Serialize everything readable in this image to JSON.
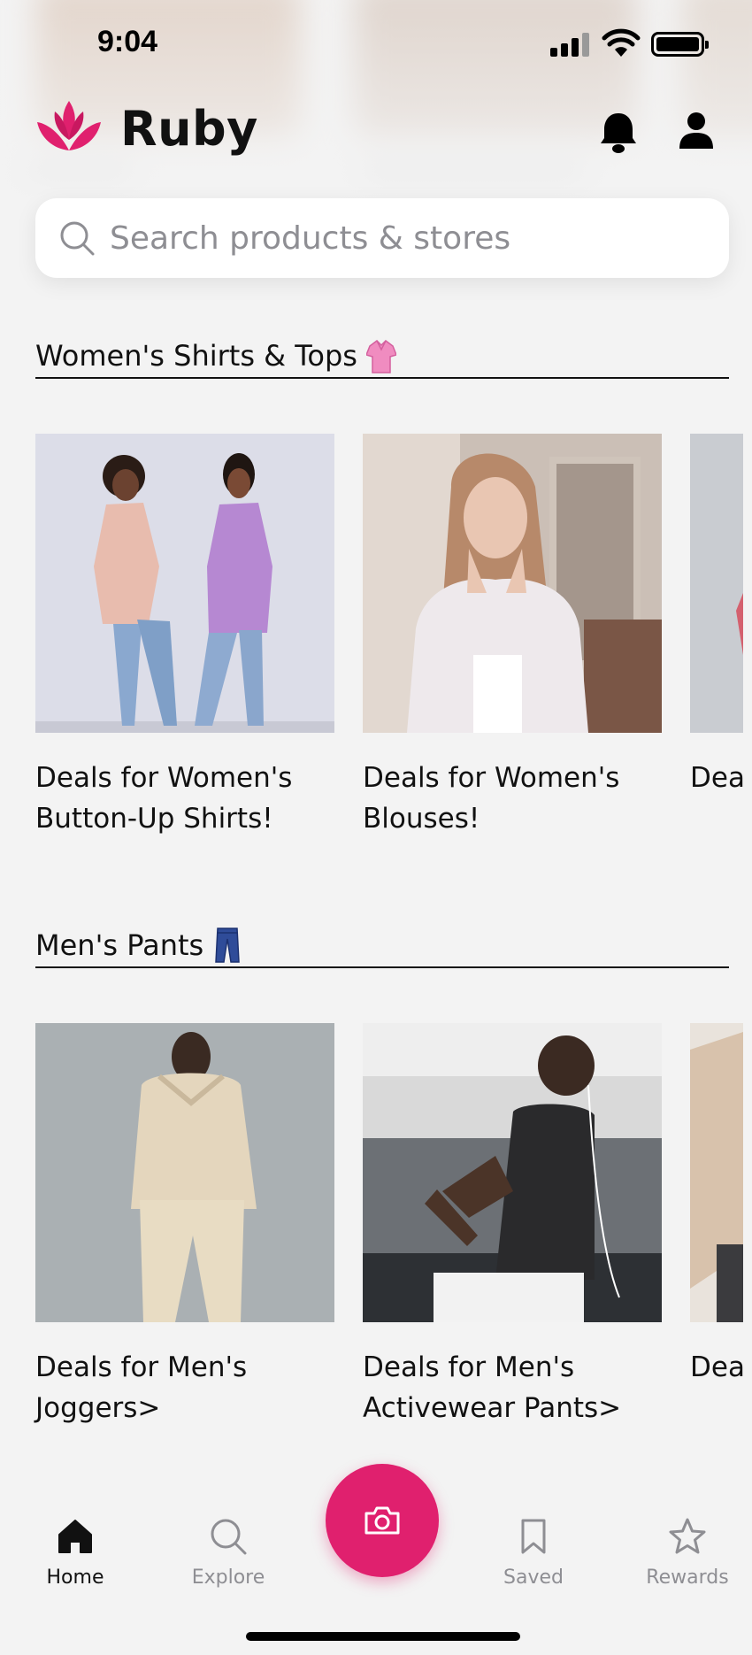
{
  "status_bar": {
    "time": "9:04"
  },
  "header": {
    "brand": "Ruby"
  },
  "search": {
    "placeholder": "Search products & stores"
  },
  "sections": [
    {
      "title": "Women's Shirts & Tops",
      "emoji": "blouse-emoji",
      "cards": [
        {
          "caption": "Deals for Women's Button-Up Shirts!"
        },
        {
          "caption": "Deals for Women's Blouses!"
        },
        {
          "caption": "Deal T-Sh"
        }
      ]
    },
    {
      "title": "Men's Pants",
      "emoji": "jeans-emoji",
      "cards": [
        {
          "caption": "Deals for Men's Joggers>"
        },
        {
          "caption": "Deals for Men's Activewear Pants>"
        },
        {
          "caption": "Deal Loun"
        }
      ]
    }
  ],
  "nav": {
    "home": "Home",
    "explore": "Explore",
    "saved": "Saved",
    "rewards": "Rewards"
  },
  "colors": {
    "accent": "#e0206e",
    "background": "#f3f3f3"
  }
}
